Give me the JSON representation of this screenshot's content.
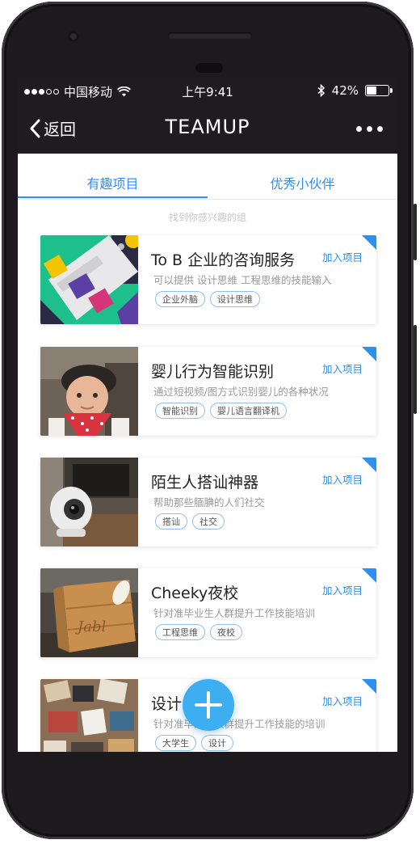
{
  "status_bar": {
    "carrier": "中国移动",
    "time": "上午9:41",
    "battery_percent": "42%",
    "battery_level": 0.42,
    "signal_dots_filled": 3,
    "signal_dots_total": 5
  },
  "nav": {
    "back_label": "返回",
    "title": "TEAMUP"
  },
  "tabs": [
    {
      "label": "有趣项目",
      "active": true
    },
    {
      "label": "优秀小伙伴",
      "active": false
    }
  ],
  "hint": "找到你感兴趣的组",
  "colors": {
    "accent": "#2d8ff0",
    "fab": "#3daef0",
    "bar": "#1f1c1f"
  },
  "projects": [
    {
      "title": "To B 企业的咨询服务",
      "description": "可以提供 设计思维 工程思维的技能输入",
      "tags": [
        "企业外脑",
        "设计思维"
      ],
      "join_label": "加入项目",
      "image": "colorful-product-ui-illustration"
    },
    {
      "title": "婴儿行为智能识别",
      "description": "通过短视频/图方式识别婴儿的各种状况",
      "tags": [
        "智能识别",
        "婴儿语言翻译机"
      ],
      "join_label": "加入项目",
      "image": "baby-photo"
    },
    {
      "title": "陌生人搭讪神器",
      "description": "帮助那些腼腆的人们社交",
      "tags": [
        "搭讪",
        "社交"
      ],
      "join_label": "加入项目",
      "image": "white-robot-camera-photo"
    },
    {
      "title": "Cheeky夜校",
      "description": "针对准毕业生人群提升工作技能培训",
      "tags": [
        "工程思维",
        "夜校"
      ],
      "join_label": "加入项目",
      "image": "wooden-box-photo"
    },
    {
      "title": "设计",
      "description": "针对准毕业生人群提升工作技能的培训",
      "tags": [
        "大学生",
        "设计"
      ],
      "join_label": "加入项目",
      "image": "craft-supplies-photo"
    }
  ]
}
